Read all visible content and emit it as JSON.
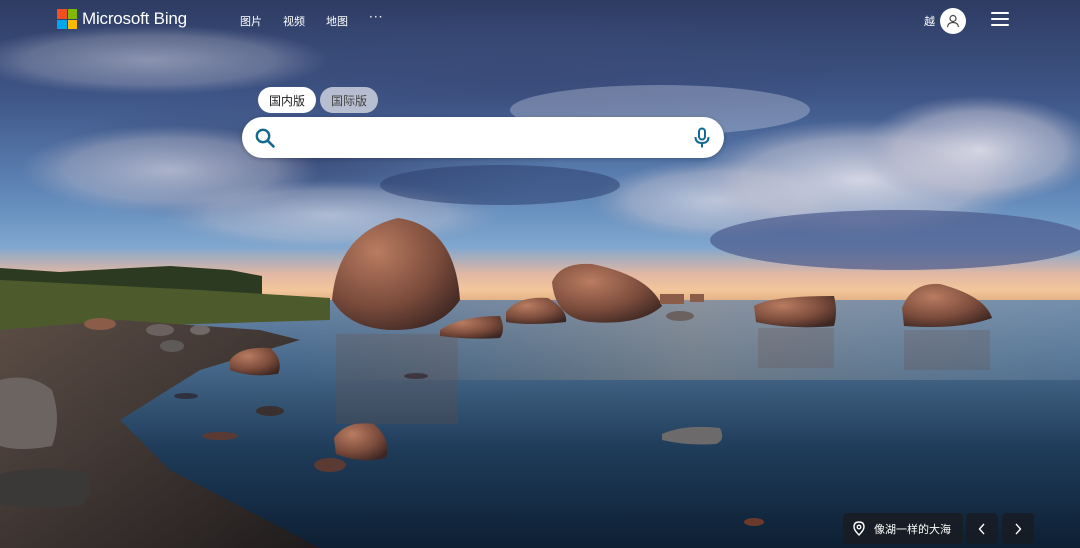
{
  "header": {
    "brand": "Microsoft Bing",
    "brand_colors": [
      "#f25022",
      "#7fba00",
      "#00a4ef",
      "#ffb900"
    ],
    "nav": [
      "图片",
      "视频",
      "地图"
    ],
    "more_label": "···",
    "user_name": "越"
  },
  "scope_tabs": [
    {
      "label": "国内版",
      "active": true
    },
    {
      "label": "国际版",
      "active": false
    }
  ],
  "search": {
    "value": "",
    "placeholder": "",
    "accent": "#13698f"
  },
  "image_info": {
    "location_text": "像湖一样的大海"
  }
}
